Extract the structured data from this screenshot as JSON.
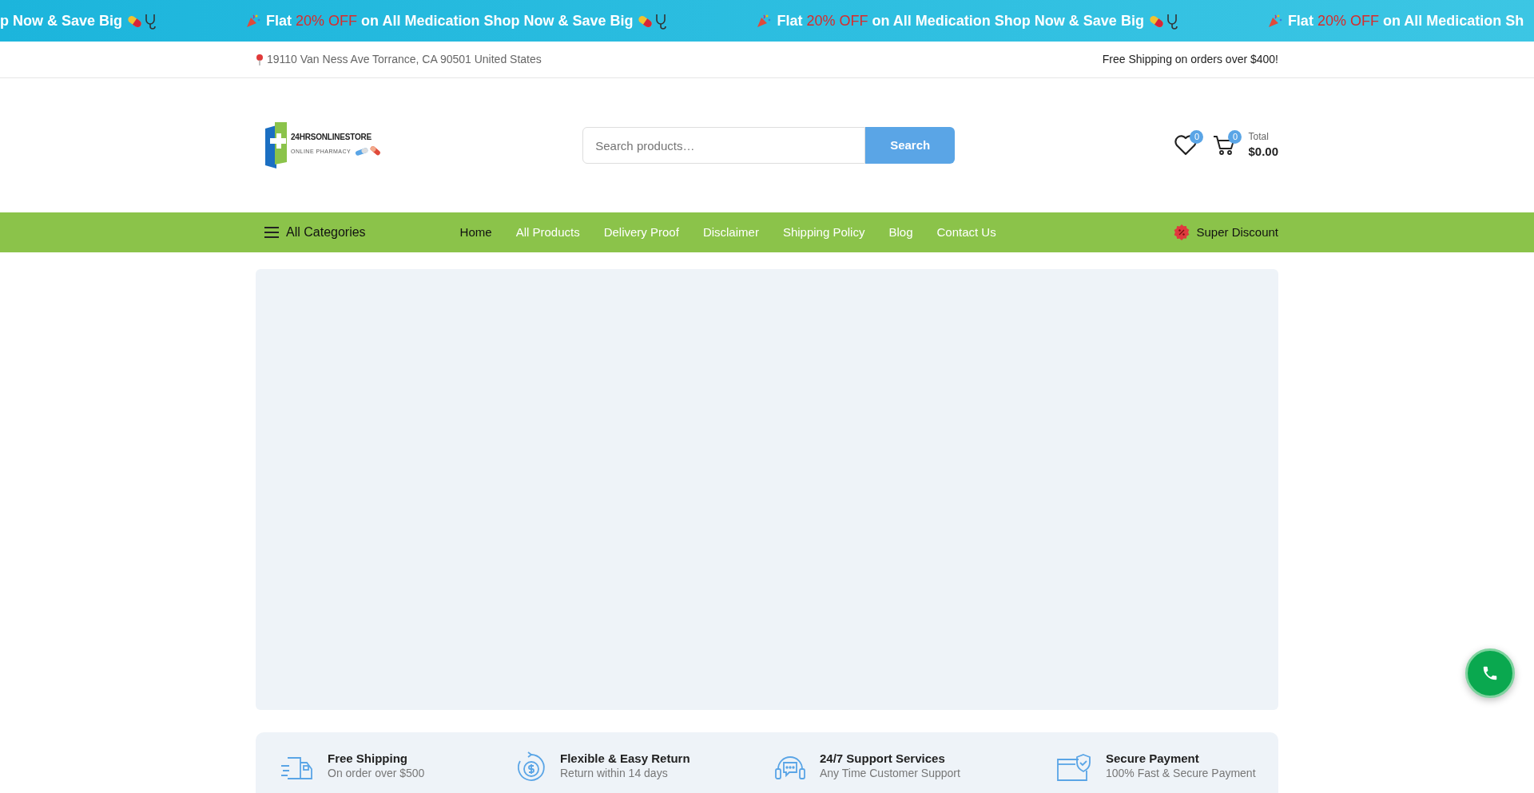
{
  "promo_banner": {
    "items": [
      {
        "kind": "tail",
        "rest": "p Now & Save Big"
      },
      {
        "kind": "full",
        "lead": "Flat",
        "highlight": "20% OFF",
        "rest": "on All Medication Shop Now & Save Big"
      },
      {
        "kind": "full",
        "lead": "Flat",
        "highlight": "20% OFF",
        "rest": "on All Medication Shop Now & Save Big"
      },
      {
        "kind": "head",
        "lead": "Flat",
        "highlight": "20% OFF",
        "rest": "on All Medication Sh"
      }
    ]
  },
  "top_bar": {
    "address": "19110 Van Ness Ave Torrance, CA 90501 United States",
    "shipping_note": "Free Shipping on orders over $400!"
  },
  "header": {
    "logo": {
      "name": "24HRSONLINESTORE",
      "tagline": "ONLINE PHARMACY"
    },
    "search": {
      "placeholder": "Search products…",
      "button": "Search"
    },
    "wishlist": {
      "count": "0"
    },
    "cart": {
      "count": "0",
      "total_label": "Total",
      "total": "$0.00"
    }
  },
  "nav": {
    "categories": "All Categories",
    "links": [
      {
        "label": "Home",
        "selected": true
      },
      {
        "label": "All Products",
        "selected": false
      },
      {
        "label": "Delivery Proof",
        "selected": false
      },
      {
        "label": "Disclaimer",
        "selected": false
      },
      {
        "label": "Shipping Policy",
        "selected": false
      },
      {
        "label": "Blog",
        "selected": false
      },
      {
        "label": "Contact Us",
        "selected": false
      }
    ],
    "discount": "Super Discount"
  },
  "features": [
    {
      "kind": "shipping",
      "title": "Free Shipping",
      "subtitle": "On order over $500"
    },
    {
      "kind": "return",
      "title": "Flexible & Easy Return",
      "subtitle": "Return within 14 days"
    },
    {
      "kind": "support",
      "title": "24/7 Support Services",
      "subtitle": "Any Time Customer Support"
    },
    {
      "kind": "payment",
      "title": "Secure Payment",
      "subtitle": "100% Fast & Secure Payment"
    }
  ]
}
